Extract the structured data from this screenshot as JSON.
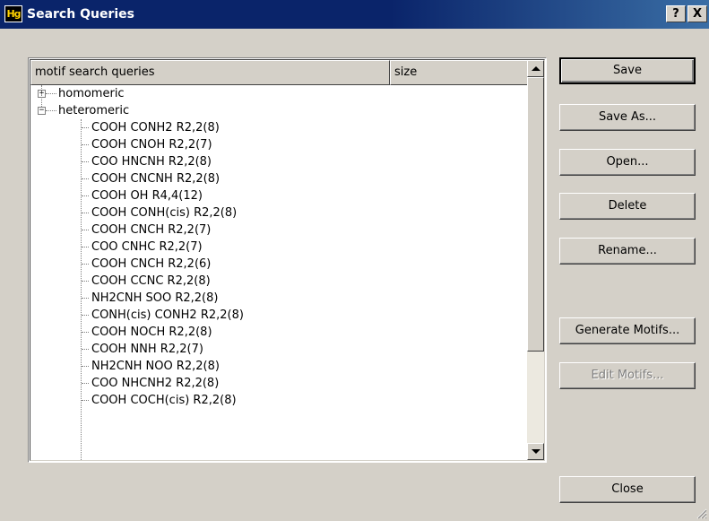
{
  "window": {
    "title": "Search Queries",
    "app_icon_text": "Hg",
    "help_label": "?",
    "close_label": "X"
  },
  "list": {
    "columns": [
      "motif search queries",
      "size"
    ],
    "tree": [
      {
        "label": "homomeric",
        "expanded": false
      },
      {
        "label": "heteromeric",
        "expanded": true
      }
    ],
    "children": [
      "COOH CONH2 R2,2(8)",
      "COOH CNOH R2,2(7)",
      "COO HNCNH R2,2(8)",
      "COOH CNCNH R2,2(8)",
      "COOH OH R4,4(12)",
      "COOH CONH(cis) R2,2(8)",
      "COOH CNCH R2,2(7)",
      "COO CNHC R2,2(7)",
      "COOH CNCH R2,2(6)",
      "COOH CCNC R2,2(8)",
      "NH2CNH SOO R2,2(8)",
      "CONH(cis) CONH2 R2,2(8)",
      "COOH NOCH R2,2(8)",
      "COOH NNH R2,2(7)",
      "NH2CNH NOO R2,2(8)",
      "COO NHCNH2 R2,2(8)",
      "COOH COCH(cis) R2,2(8)"
    ]
  },
  "buttons": {
    "save": "Save",
    "save_as": "Save As...",
    "open": "Open...",
    "delete": "Delete",
    "rename": "Rename...",
    "generate_motifs": "Generate Motifs...",
    "edit_motifs": "Edit Motifs...",
    "close": "Close"
  },
  "colors": {
    "titlebar": "#0a246a",
    "face": "#d4d0c8",
    "list_bg": "#ffffff",
    "disabled_text": "#808080"
  }
}
